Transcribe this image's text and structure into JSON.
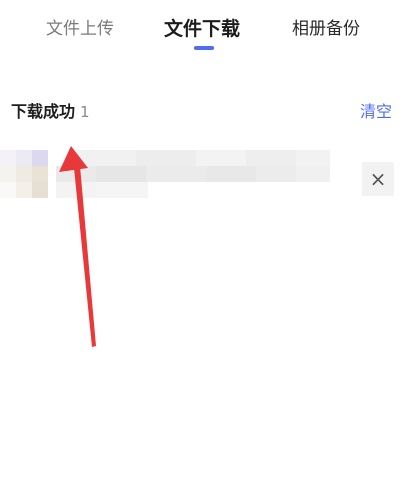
{
  "tabs": [
    {
      "label": "文件上传"
    },
    {
      "label": "文件下载"
    },
    {
      "label": "相册备份"
    }
  ],
  "section": {
    "title": "下载成功",
    "count": "1",
    "clear_label": "清空"
  },
  "item": {
    "close_glyph": "×"
  },
  "colors": {
    "accent": "#4f6cf3",
    "arrow": "#e8383a"
  },
  "icons": {
    "close": "close-icon",
    "annotation": "red-arrow-annotation"
  }
}
